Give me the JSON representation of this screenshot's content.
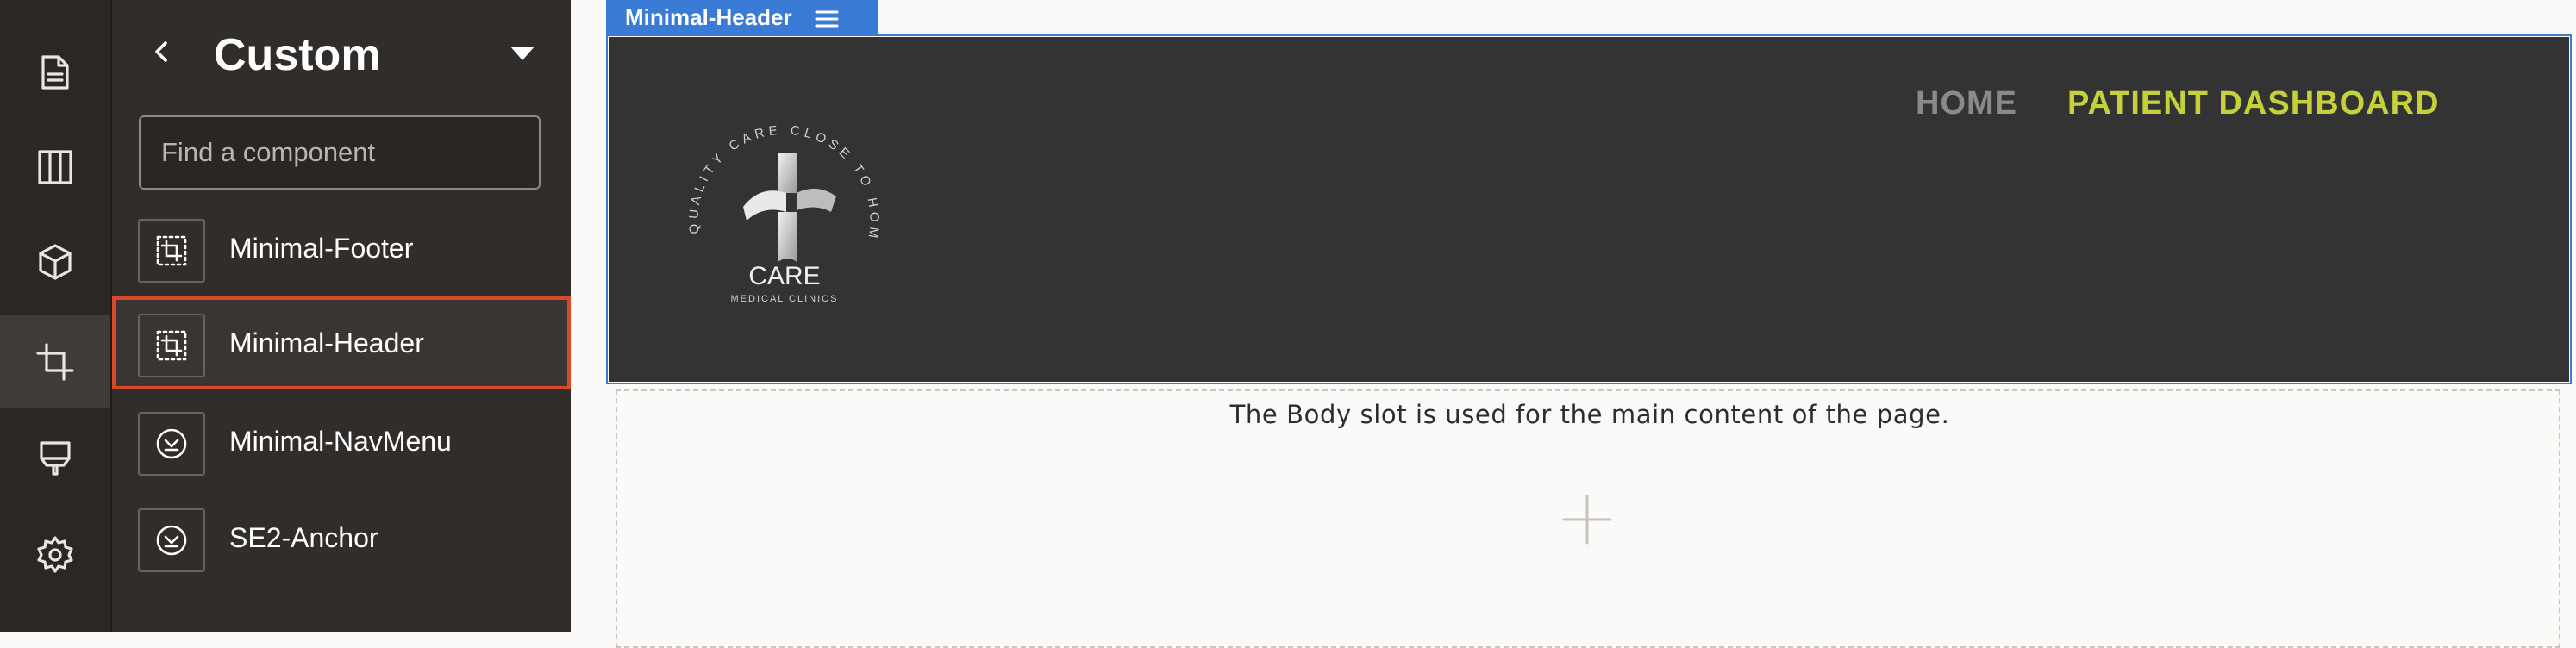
{
  "rail": {
    "items": [
      {
        "icon": "pages-icon"
      },
      {
        "icon": "layout-icon"
      },
      {
        "icon": "components-icon"
      },
      {
        "icon": "crop-icon",
        "active": true
      },
      {
        "icon": "theme-icon"
      },
      {
        "icon": "settings-icon"
      }
    ]
  },
  "panel": {
    "title": "Custom",
    "search_placeholder": "Find a component",
    "components": [
      {
        "label": "Minimal-Footer",
        "icon": "crop-square-icon"
      },
      {
        "label": "Minimal-Header",
        "icon": "crop-square-icon",
        "selected": true
      },
      {
        "label": "Minimal-NavMenu",
        "icon": "circle-chevron-down-icon"
      },
      {
        "label": "SE2-Anchor",
        "icon": "circle-chevron-down-icon"
      }
    ]
  },
  "canvas": {
    "slot_tag": "Minimal-Header",
    "nav": {
      "home": "HOME",
      "dashboard": "PATIENT DASHBOARD"
    },
    "logo": {
      "arc_text": "QUALITY CARE CLOSE TO HOME.",
      "name": "CARE",
      "subtitle": "MEDICAL CLINICS"
    },
    "body_slot_text": "The Body slot is used for the main content of the page."
  },
  "colors": {
    "accent_blue": "#3a7bd5",
    "selection_red": "#d8482b",
    "nav_active": "#c6d13a",
    "header_bg": "#333333"
  }
}
